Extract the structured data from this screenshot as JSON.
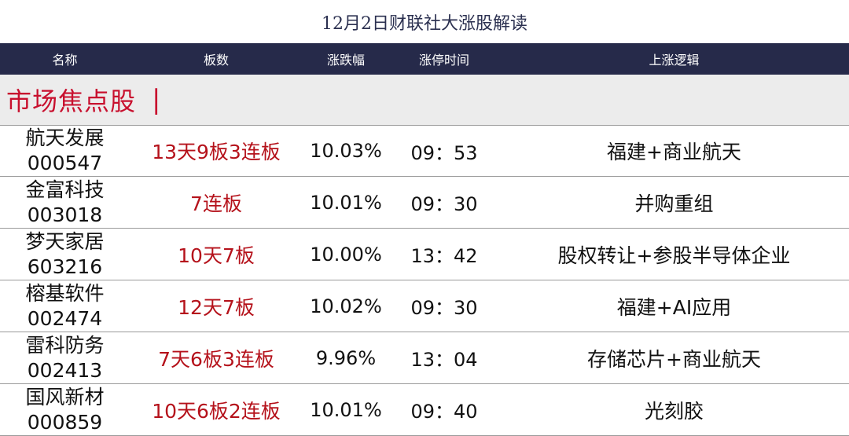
{
  "title": "12月2日财联社大涨股解读",
  "header": {
    "name": "名称",
    "board": "板数",
    "pct": "涨跌幅",
    "time": "涨停时间",
    "logic": "上涨逻辑"
  },
  "section": {
    "label": "市场焦点股",
    "bar": "|"
  },
  "rows": [
    {
      "name": "航天发展",
      "code": "000547",
      "board": "13天9板3连板",
      "pct": "10.03%",
      "time": "09：53",
      "logic": "福建+商业航天"
    },
    {
      "name": "金富科技",
      "code": "003018",
      "board": "7连板",
      "pct": "10.01%",
      "time": "09：30",
      "logic": "并购重组"
    },
    {
      "name": "梦天家居",
      "code": "603216",
      "board": "10天7板",
      "pct": "10.00%",
      "time": "13：42",
      "logic": "股权转让+参股半导体企业"
    },
    {
      "name": "榕基软件",
      "code": "002474",
      "board": "12天7板",
      "pct": "10.02%",
      "time": "09：30",
      "logic": "福建+AI应用"
    },
    {
      "name": "雷科防务",
      "code": "002413",
      "board": "7天6板3连板",
      "pct": "9.96%",
      "time": "13：04",
      "logic": "存储芯片+商业航天"
    },
    {
      "name": "国风新材",
      "code": "000859",
      "board": "10天6板2连板",
      "pct": "10.01%",
      "time": "09：40",
      "logic": "光刻胶"
    }
  ]
}
